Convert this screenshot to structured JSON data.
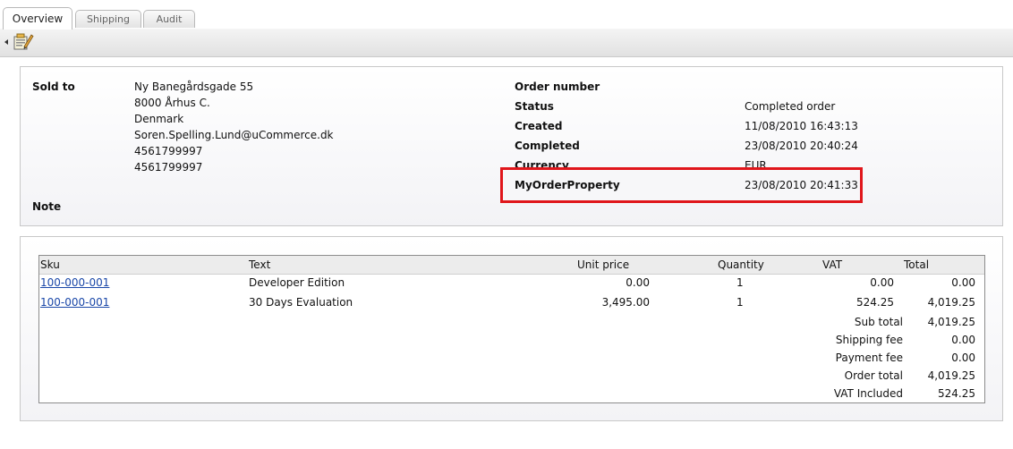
{
  "tabs": [
    {
      "label": "Overview",
      "active": true
    },
    {
      "label": "Shipping",
      "active": false
    },
    {
      "label": "Audit",
      "active": false
    }
  ],
  "toolbar": {
    "icon": "properties-icon"
  },
  "customer": {
    "sold_to_label": "Sold to",
    "address_lines": [
      "Ny Banegårdsgade 55",
      "8000 Århus C.",
      "Denmark",
      "Soren.Spelling.Lund@uCommerce.dk",
      "4561799997",
      "4561799997"
    ],
    "note_label": "Note"
  },
  "order_info": {
    "order_number_label": "Order number",
    "order_number_value": "",
    "status_label": "Status",
    "status_value": "Completed order",
    "created_label": "Created",
    "created_value": "11/08/2010 16:43:13",
    "completed_label": "Completed",
    "completed_value": "23/08/2010 20:40:24",
    "currency_label": "Currency",
    "currency_value": "EUR",
    "custom_label": "MyOrderProperty",
    "custom_value": "23/08/2010 20:41:33"
  },
  "highlight_color": "#e0161b",
  "lines": {
    "headers": {
      "sku": "Sku",
      "text": "Text",
      "unit_price": "Unit price",
      "quantity": "Quantity",
      "vat": "VAT",
      "total": "Total"
    },
    "rows": [
      {
        "sku": "100-000-001",
        "text": "Developer Edition",
        "unit_price": "0.00",
        "quantity": "1",
        "vat": "0.00",
        "total": "0.00"
      },
      {
        "sku": "100-000-001",
        "text": "30 Days Evaluation",
        "unit_price": "3,495.00",
        "quantity": "1",
        "vat": "524.25",
        "total": "4,019.25"
      }
    ],
    "summary": [
      {
        "label": "Sub total",
        "value": "4,019.25"
      },
      {
        "label": "Shipping fee",
        "value": "0.00"
      },
      {
        "label": "Payment fee",
        "value": "0.00"
      },
      {
        "label": "Order total",
        "value": "4,019.25"
      },
      {
        "label": "VAT Included",
        "value": "524.25"
      }
    ]
  }
}
